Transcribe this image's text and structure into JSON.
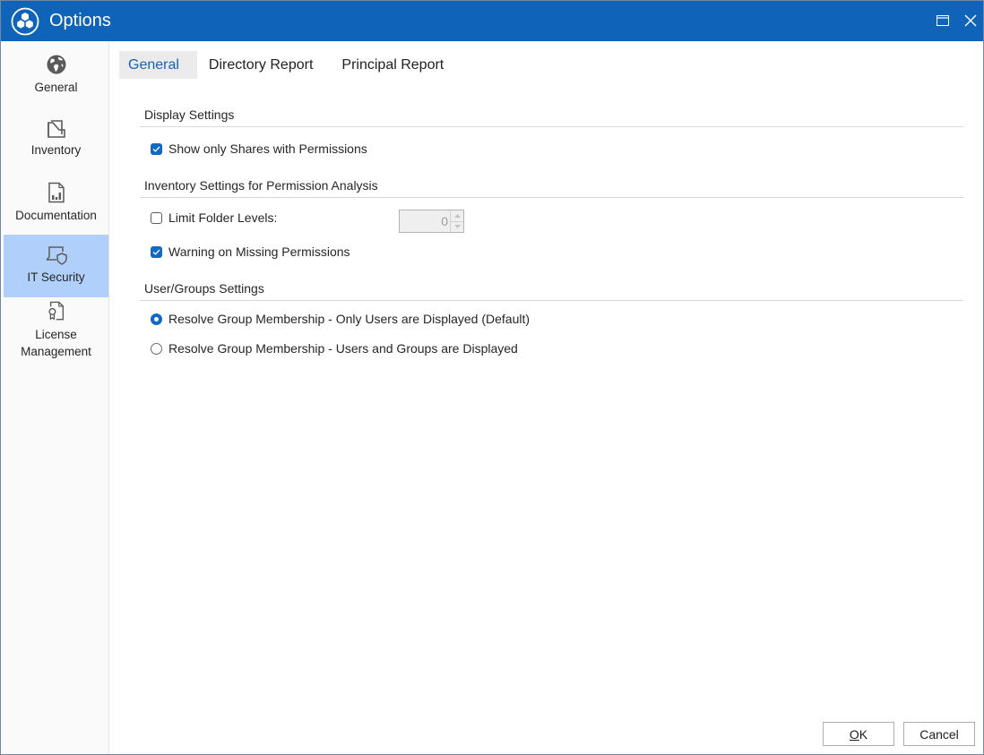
{
  "window": {
    "title": "Options",
    "accent_color": "#0f64ba",
    "controls": {
      "maximize": "maximize-icon",
      "close": "close-icon"
    }
  },
  "sidebar": {
    "items": [
      {
        "label": "General",
        "icon": "globe-icon",
        "active": false
      },
      {
        "label": "Inventory",
        "icon": "folder-stack-icon",
        "active": false
      },
      {
        "label": "Documentation",
        "icon": "document-chart-icon",
        "active": false
      },
      {
        "label": "IT Security",
        "icon": "laptop-shield-icon",
        "active": true
      },
      {
        "label_line1": "License",
        "label_line2": "Management",
        "icon": "certificate-document-icon",
        "active": false
      }
    ]
  },
  "tabs": [
    {
      "label": "General",
      "active": true
    },
    {
      "label": "Directory Report",
      "active": false
    },
    {
      "label": "Principal Report",
      "active": false
    }
  ],
  "sections": {
    "display": {
      "title": "Display Settings",
      "options": [
        {
          "label": "Show only Shares with Permissions",
          "type": "checkbox",
          "checked": true
        }
      ]
    },
    "inventory": {
      "title": "Inventory Settings for Permission Analysis",
      "limit_folder_levels": {
        "label": "Limit Folder Levels:",
        "type": "checkbox",
        "checked": false,
        "value": "0",
        "enabled": false
      },
      "warning_missing": {
        "label": "Warning on Missing Permissions",
        "type": "checkbox",
        "checked": true
      }
    },
    "user_groups": {
      "title": "User/Groups Settings",
      "options": [
        {
          "label": "Resolve Group Membership - Only Users are Displayed (Default)",
          "type": "radio",
          "checked": true
        },
        {
          "label": "Resolve Group Membership - Users and Groups are Displayed",
          "type": "radio",
          "checked": false
        }
      ]
    }
  },
  "footer": {
    "ok_accel": "O",
    "ok_rest": "K",
    "cancel_label": "Cancel"
  }
}
